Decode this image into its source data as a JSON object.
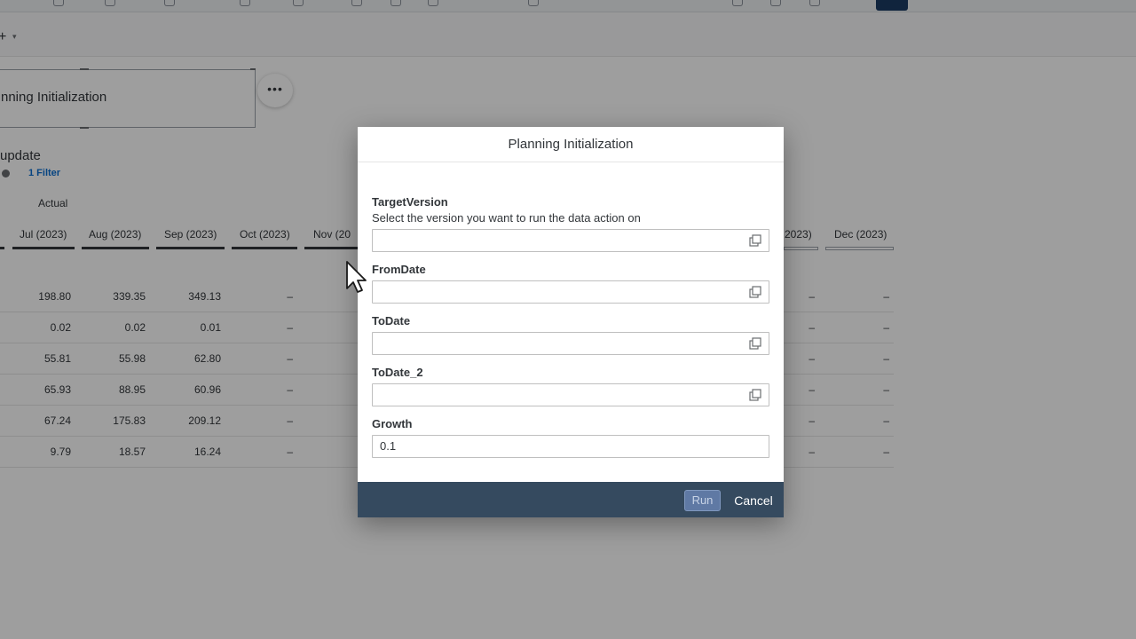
{
  "canvas": {
    "story_title": "nning Initialization",
    "chart_title": "update",
    "filter_label": "1 Filter",
    "measure_label": "Actual",
    "more_glyph": "•••"
  },
  "table": {
    "headers": [
      "Jul (2023)",
      "Aug (2023)",
      "Sep (2023)",
      "Oct (2023)",
      "Nov (20",
      "2023)",
      "Dec (2023)"
    ],
    "rows": [
      [
        "198.80",
        "339.35",
        "349.13",
        "–",
        "–",
        "–"
      ],
      [
        "0.02",
        "0.02",
        "0.01",
        "–",
        "–",
        "–"
      ],
      [
        "55.81",
        "55.98",
        "62.80",
        "–",
        "–",
        "–"
      ],
      [
        "65.93",
        "88.95",
        "60.96",
        "–",
        "–",
        "–"
      ],
      [
        "67.24",
        "175.83",
        "209.12",
        "–",
        "–",
        "–"
      ],
      [
        "9.79",
        "18.57",
        "16.24",
        "–",
        "–",
        "–"
      ]
    ]
  },
  "dialog": {
    "title": "Planning Initialization",
    "fields": [
      {
        "label": "TargetVersion",
        "help": "Select the version you want to run the data action on",
        "value": ""
      },
      {
        "label": "FromDate",
        "value": ""
      },
      {
        "label": "ToDate",
        "value": ""
      },
      {
        "label": "ToDate_2",
        "value": ""
      },
      {
        "label": "Growth",
        "value": "0.1"
      }
    ],
    "run_label": "Run",
    "cancel_label": "Cancel"
  },
  "colors": {
    "footer": "#354a5f",
    "run_button": "#5f79a4",
    "link": "#0a6ed1"
  },
  "icons": [
    "value-help-icon",
    "plus-icon",
    "chevron-down-icon",
    "filter-icon",
    "more-icon",
    "mouse-cursor-icon"
  ]
}
